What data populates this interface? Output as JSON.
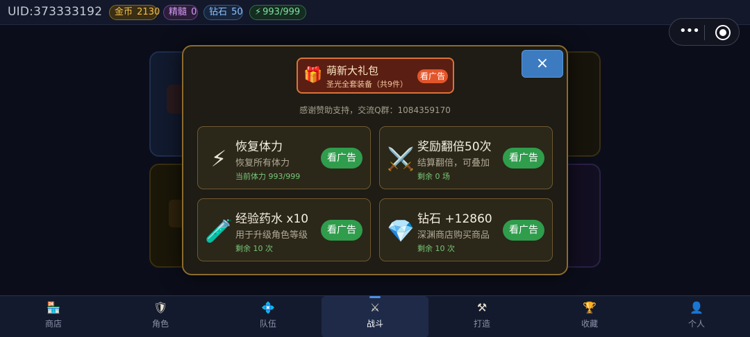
{
  "topbar": {
    "uid": "UID:373333192",
    "gold_label": "金币",
    "gold_value": "2130",
    "essence_label": "精髓",
    "essence_value": "0",
    "diamond_label": "钻石",
    "diamond_value": "50",
    "energy_icon": "⚡",
    "energy_value": "993/999"
  },
  "capsule": {
    "more_icon": "•••",
    "close_icon": "ring"
  },
  "dialog": {
    "close_label": "×",
    "gift": {
      "icon": "🎁",
      "title": "萌新大礼包",
      "subtitle": "圣光全套装备（共9件）",
      "button": "看广告"
    },
    "thanks": "感谢赞助支持，交流Q群：1084359170",
    "cards": [
      {
        "icon": "⚡",
        "title": "恢复体力",
        "desc": "恢复所有体力",
        "meta": "当前体力 993/999",
        "button": "看广告"
      },
      {
        "icon": "⚔️",
        "title": "奖励翻倍50次",
        "desc": "结算翻倍，可叠加",
        "meta": "剩余 0 场",
        "button": "看广告"
      },
      {
        "icon": "🧪",
        "title": "经验药水 x10",
        "desc": "用于升级角色等级",
        "meta": "剩余 10 次",
        "button": "看广告"
      },
      {
        "icon": "💎",
        "title": "钻石 +12860",
        "desc": "深渊商店购买商品",
        "meta": "剩余 10 次",
        "button": "看广告"
      }
    ]
  },
  "bottomnav": {
    "items": [
      {
        "label": "商店",
        "icon": "🏪"
      },
      {
        "label": "角色",
        "icon": "🛡"
      },
      {
        "label": "队伍",
        "icon": "💠"
      },
      {
        "label": "战斗",
        "icon": "⚔"
      },
      {
        "label": "打造",
        "icon": "⚒"
      },
      {
        "label": "收藏",
        "icon": "🏆"
      },
      {
        "label": "个人",
        "icon": "👤"
      }
    ]
  },
  "colors": {
    "accent_blue": "#3d7bc0",
    "ad_green": "#2f9d4c",
    "gift_orange": "#e2552b",
    "gold": "#f3c04d"
  }
}
